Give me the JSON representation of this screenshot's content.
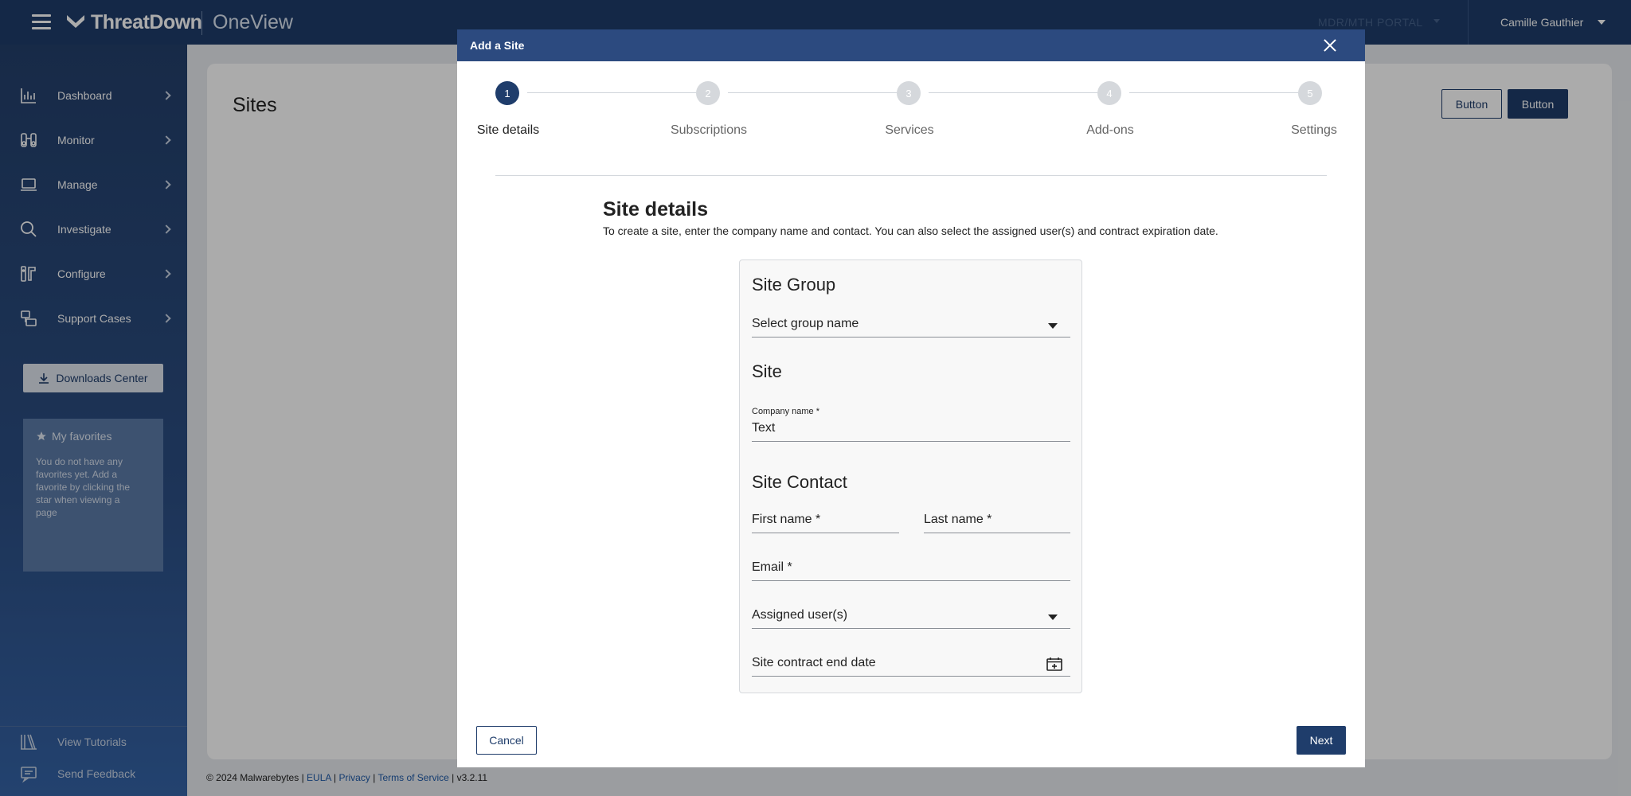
{
  "topbar": {
    "logo_text": "ThreatDown",
    "product_name": "OneView",
    "portal_switch": "MDR/MTH PORTAL",
    "user_name": "Camille Gauthier"
  },
  "sidebar": {
    "items": [
      {
        "label": "Dashboard",
        "icon": "bar-chart-icon"
      },
      {
        "label": "Monitor",
        "icon": "binoculars-icon"
      },
      {
        "label": "Manage",
        "icon": "laptop-icon"
      },
      {
        "label": "Investigate",
        "icon": "search-icon"
      },
      {
        "label": "Configure",
        "icon": "configure-icon"
      },
      {
        "label": "Support Cases",
        "icon": "support-cases-icon"
      }
    ],
    "downloads_label": "Downloads Center",
    "favorites": {
      "title": "My favorites",
      "empty_text": "You do not have any favorites yet. Add a favorite by clicking the star when viewing a page"
    },
    "bottom": {
      "tutorials_label": "View Tutorials",
      "feedback_label": "Send Feedback"
    }
  },
  "page": {
    "title": "Sites",
    "button_outline": "Button",
    "button_filled": "Button"
  },
  "footer": {
    "copyright": "© 2024 Malwarebytes",
    "sep": " | ",
    "eula": "EULA",
    "privacy": "Privacy",
    "terms": "Terms of Service",
    "version": "v3.2.11"
  },
  "modal": {
    "title": "Add a Site",
    "steps": [
      {
        "number": "1",
        "label": "Site details"
      },
      {
        "number": "2",
        "label": "Subscriptions"
      },
      {
        "number": "3",
        "label": "Services"
      },
      {
        "number": "4",
        "label": "Add-ons"
      },
      {
        "number": "5",
        "label": "Settings"
      }
    ],
    "active_step": 1,
    "section_title": "Site details",
    "section_desc": "To create a site, enter the company name and contact. You can also select the assigned user(s) and contract expiration date.",
    "form": {
      "site_group_heading": "Site Group",
      "group_select_placeholder": "Select group name",
      "site_heading": "Site",
      "company_label": "Company name *",
      "company_value": "Text",
      "contact_heading": "Site Contact",
      "first_name_label": "First name *",
      "last_name_label": "Last name *",
      "email_label": "Email *",
      "assigned_users_label": "Assigned user(s)",
      "contract_end_label": "Site contract end date"
    },
    "cancel_label": "Cancel",
    "next_label": "Next"
  },
  "colors": {
    "brand_navy": "#1f3d6b",
    "modal_header": "#2c4a7f",
    "step_inactive": "#d5d8dc"
  }
}
